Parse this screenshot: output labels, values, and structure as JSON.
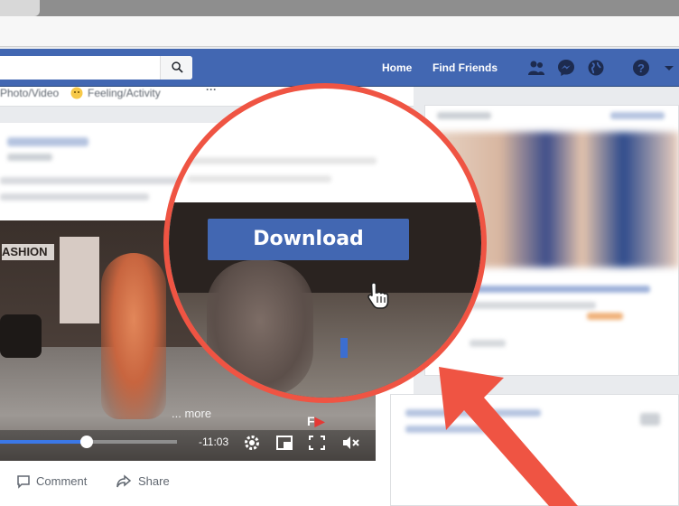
{
  "header": {
    "nav_home": "Home",
    "nav_find_friends": "Find Friends",
    "icons": [
      "friends-icon",
      "messenger-icon",
      "globe-icon",
      "help-icon",
      "chevron-down-icon"
    ]
  },
  "composer": {
    "photo_video": "Photo/Video",
    "feeling": "Feeling/Activity",
    "more": "···"
  },
  "video": {
    "caption": "... more",
    "time": "-11:03",
    "logo_text": "F",
    "progress": 0.23
  },
  "post_actions": {
    "comment": "Comment",
    "share": "Share"
  },
  "overlay": {
    "download_label": "Download"
  },
  "colors": {
    "fb_blue": "#4267b2",
    "lens_border": "#ef5443",
    "arrow": "#ef5443"
  }
}
